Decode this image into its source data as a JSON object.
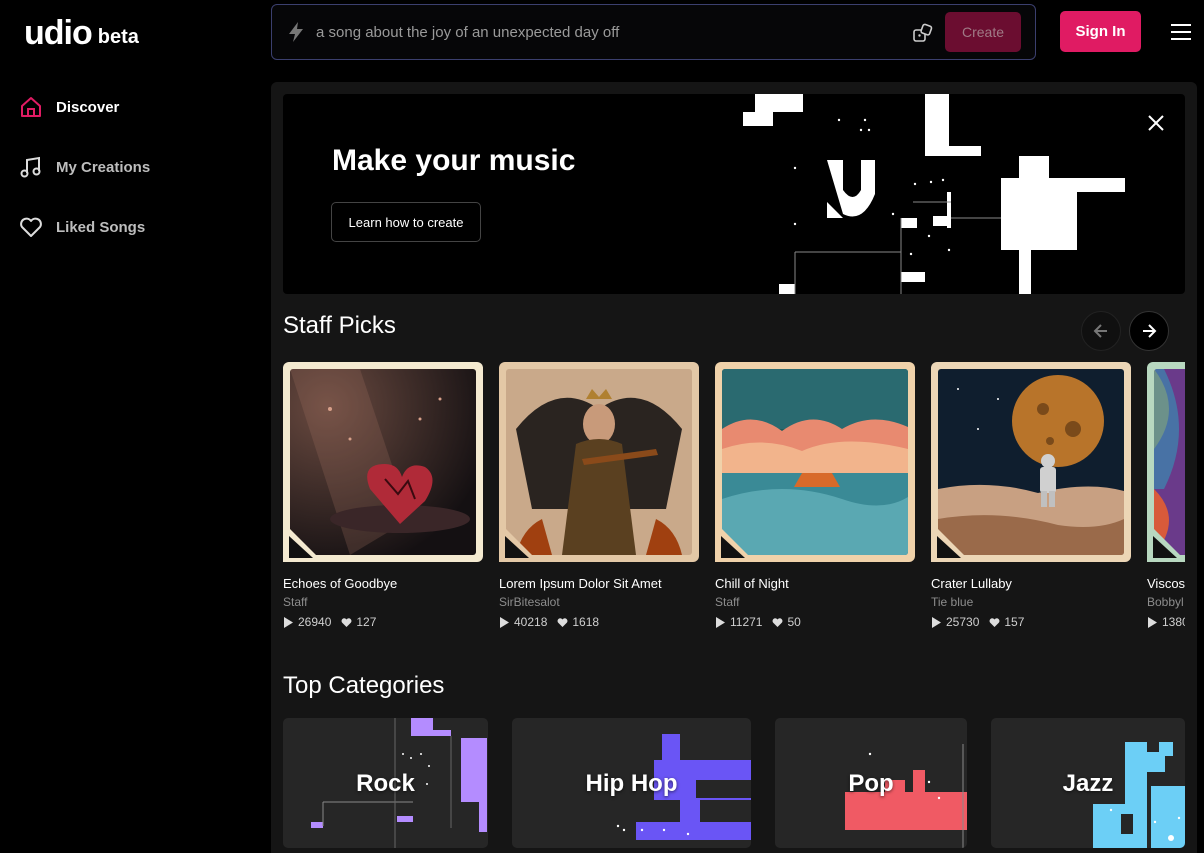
{
  "brand": {
    "logo": "udio",
    "badge": "beta"
  },
  "nav": [
    {
      "label": "Discover",
      "icon": "home-icon",
      "active": true
    },
    {
      "label": "My Creations",
      "icon": "music-note-icon",
      "active": false
    },
    {
      "label": "Liked Songs",
      "icon": "heart-icon",
      "active": false
    }
  ],
  "header": {
    "prompt_placeholder": "a song about the joy of an unexpected day off",
    "create_label": "Create",
    "signin_label": "Sign In"
  },
  "banner": {
    "title": "Make your music",
    "button_label": "Learn how to create"
  },
  "staff_picks": {
    "title": "Staff Picks",
    "cards": [
      {
        "title": "Echoes of Goodbye",
        "author": "Staff",
        "plays": "26940",
        "likes": "127"
      },
      {
        "title": "Lorem Ipsum Dolor Sit Amet",
        "author": "SirBitesalot",
        "plays": "40218",
        "likes": "1618"
      },
      {
        "title": "Chill of Night",
        "author": "Staff",
        "plays": "11271",
        "likes": "50"
      },
      {
        "title": "Crater Lullaby",
        "author": "Tie blue",
        "plays": "25730",
        "likes": "157"
      },
      {
        "title": "Viscos",
        "author": "Bobbyl",
        "plays": "1380",
        "likes": ""
      }
    ]
  },
  "top_categories": {
    "title": "Top Categories",
    "items": [
      {
        "label": "Rock",
        "color": "#b48cff"
      },
      {
        "label": "Hip Hop",
        "color": "#6a55f5"
      },
      {
        "label": "Pop",
        "color": "#f05a64"
      },
      {
        "label": "Jazz",
        "color": "#6ccff6"
      }
    ]
  },
  "colors": {
    "accent": "#e01b63",
    "create_disabled": "#6b0d30",
    "panel": "#151515"
  }
}
